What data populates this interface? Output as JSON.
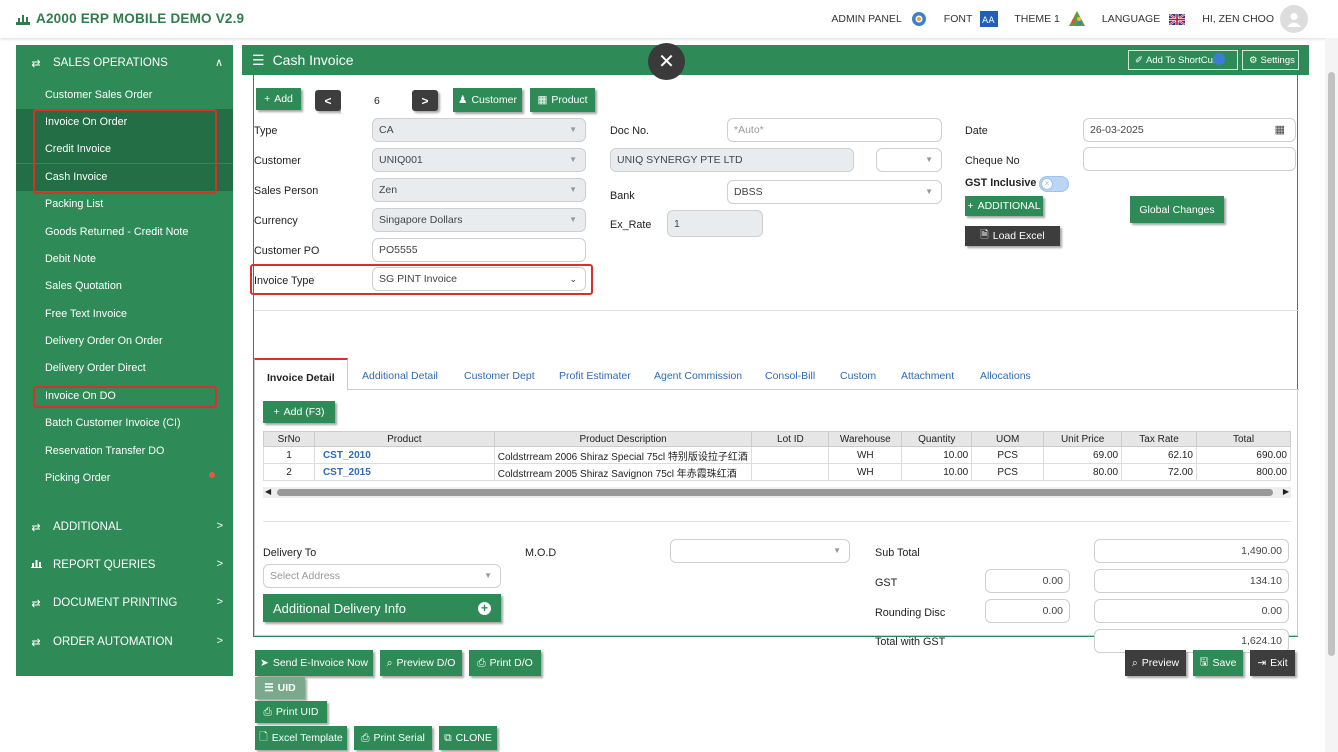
{
  "app": {
    "title": "A2000 ERP MOBILE DEMO V2.9"
  },
  "topnav": {
    "admin": "ADMIN PANEL",
    "font": "FONT",
    "theme": "THEME 1",
    "language": "LANGUAGE",
    "user": "HI, ZEN CHOO"
  },
  "sidebar": {
    "sections": {
      "sales": "SALES OPERATIONS",
      "additional": "ADDITIONAL",
      "reports": "REPORT QUERIES",
      "printing": "DOCUMENT PRINTING",
      "automation": "ORDER AUTOMATION"
    },
    "items": [
      "Customer Sales Order",
      "Invoice On Order",
      "Credit Invoice",
      "Cash Invoice",
      "Packing List",
      "Goods Returned - Credit Note",
      "Debit Note",
      "Sales Quotation",
      "Free Text Invoice",
      "Delivery Order On Order",
      "Delivery Order Direct",
      "Invoice On DO",
      "Batch Customer Invoice (CI)",
      "Reservation Transfer DO",
      "Picking Order"
    ]
  },
  "page": {
    "title": "Cash Invoice",
    "shortcut": "Add To ShortCut",
    "settings": "Settings"
  },
  "toolbar": {
    "add": "Add",
    "record": "6",
    "customer": "Customer",
    "product": "Product"
  },
  "form": {
    "type_label": "Type",
    "type": "CA",
    "customer_label": "Customer",
    "customer": "UNIQ001",
    "salesperson_label": "Sales Person",
    "salesperson": "Zen",
    "currency_label": "Currency",
    "currency": "Singapore Dollars",
    "po_label": "Customer PO",
    "po": "PO5555",
    "invtype_label": "Invoice Type",
    "invtype": "SG PINT Invoice",
    "docno_label": "Doc No.",
    "docno_placeholder": "*Auto*",
    "custname": "UNIQ SYNERGY PTE LTD",
    "bank_label": "Bank",
    "bank": "DBSS",
    "exrate_label": "Ex_Rate",
    "exrate": "1",
    "date_label": "Date",
    "date": "26-03-2025",
    "cheque_label": "Cheque No",
    "gst_label": "GST Inclusive",
    "additional": "ADDITIONAL",
    "load_excel": "Load Excel",
    "global": "Global Changes"
  },
  "tabs": [
    "Invoice Detail",
    "Additional Detail",
    "Customer Dept",
    "Profit Estimater",
    "Agent Commission",
    "Consol-Bill",
    "Custom",
    "Attachment",
    "Allocations"
  ],
  "detail": {
    "add": "Add (F3)",
    "columns": [
      "SrNo",
      "Product",
      "Product Description",
      "Lot ID",
      "Warehouse",
      "Quantity",
      "UOM",
      "Unit Price",
      "Tax Rate",
      "Total"
    ],
    "rows": [
      [
        "1",
        "CST_2010",
        "Coldstrream 2006 Shiraz Special 75cl 特别版设拉子红酒",
        "",
        "WH",
        "10.00",
        "PCS",
        "69.00",
        "62.10",
        "690.00"
      ],
      [
        "2",
        "CST_2015",
        "Coldstrream 2005 Shiraz Savignon 75cl 年赤霞珠红酒",
        "",
        "WH",
        "10.00",
        "PCS",
        "80.00",
        "72.00",
        "800.00"
      ]
    ]
  },
  "delivery": {
    "label": "Delivery To",
    "placeholder": "Select Address",
    "mod": "M.O.D",
    "info": "Additional Delivery Info"
  },
  "totals": {
    "subtotal_label": "Sub Total",
    "subtotal": "1,490.00",
    "gst_label": "GST",
    "gst_rate": "0.00",
    "gst": "134.10",
    "round_label": "Rounding Disc",
    "round_rate": "0.00",
    "round": "0.00",
    "total_label": "Total with GST",
    "total": "1,624.10"
  },
  "footer": {
    "send": "Send E-Invoice Now",
    "preview_do": "Preview D/O",
    "print_do": "Print D/O",
    "uid": "UID",
    "print_uid": "Print UID",
    "excel": "Excel Template",
    "print_serial": "Print Serial",
    "clone": "CLONE",
    "preview": "Preview",
    "save": "Save",
    "exit": "Exit"
  }
}
